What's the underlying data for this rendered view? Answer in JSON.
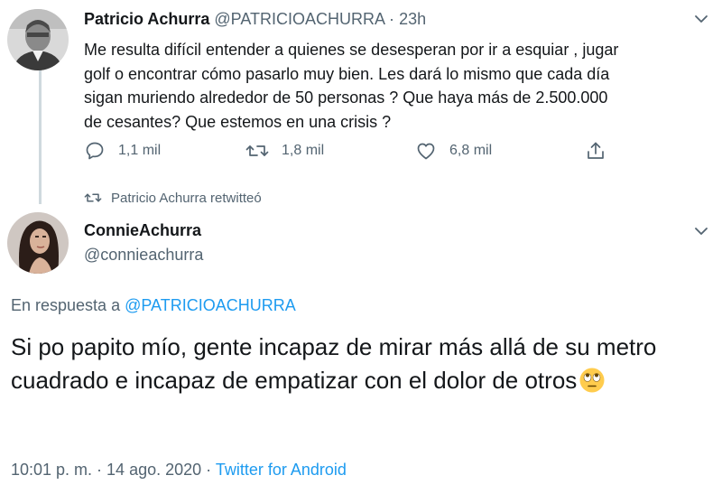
{
  "tweet1": {
    "author_name": "Patricio Achurra",
    "handle": "@PATRICIOACHURRA",
    "separator": "·",
    "time": "23h",
    "text": "Me resulta difícil entender a quienes se desesperan por ir a esquiar , jugar\ngolf o encontrar cómo pasarlo muy bien. Les dará lo mismo que cada día\nsigan muriendo alrededor de 50 personas ? Que haya más de 2.500.000\nde cesantes? Que estemos en una crisis ?",
    "reply_count": "1,1 mil",
    "retweet_count": "1,8 mil",
    "like_count": "6,8 mil"
  },
  "retweet_context": {
    "text": "Patricio Achurra retwitteó"
  },
  "tweet2": {
    "author_name": "ConnieAchurra",
    "handle": "@connieachurra",
    "reply_to_prefix": "En respuesta a",
    "reply_to_handle": "@PATRICIOACHURRA",
    "text": "Si po papito mío, gente incapaz de mirar más allá de su metro cuadrado e incapaz de empatizar con el dolor de otros",
    "timestamp": "10:01 p. m. · 14 ago. 2020 ·",
    "source": "Twitter for Android"
  },
  "icons": {
    "reply": "speech-bubble-icon",
    "retweet": "retweet-arrows-icon",
    "like": "heart-icon",
    "share": "share-upload-icon",
    "more": "chevron-down-icon",
    "emoji": "face-with-rolling-eyes-emoji"
  },
  "colors": {
    "text": "#14171a",
    "secondary": "#536471",
    "link": "#1d9bf0",
    "thread_line": "#cfd9de"
  }
}
